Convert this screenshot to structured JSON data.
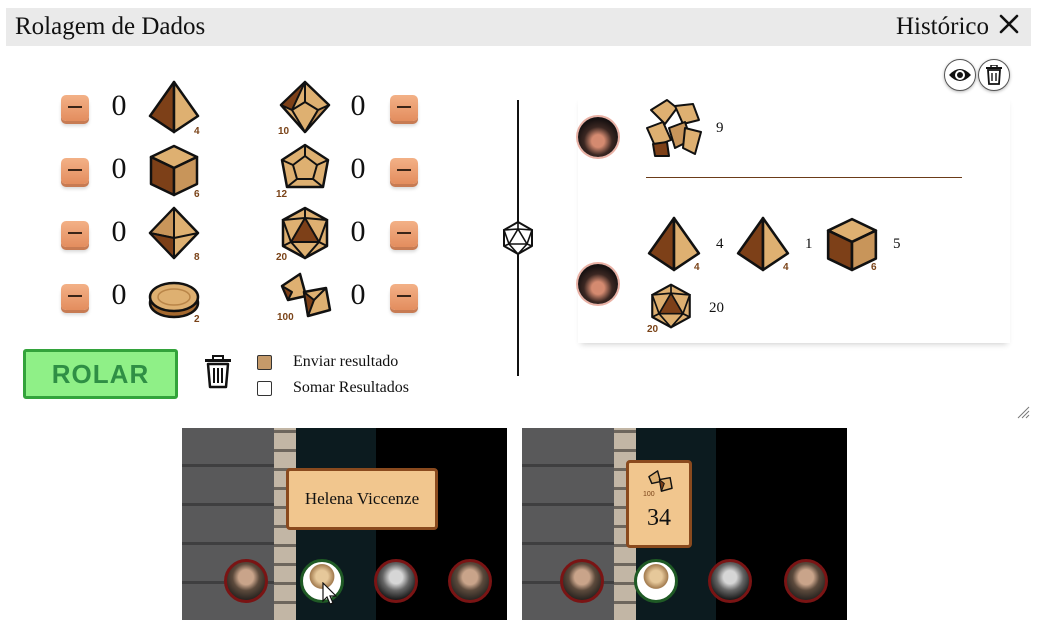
{
  "header": {
    "title": "Rolagem de Dados",
    "history_label": "Histórico"
  },
  "dice_left": [
    {
      "count": "0",
      "label": "4"
    },
    {
      "count": "0",
      "label": "6"
    },
    {
      "count": "0",
      "label": "8"
    },
    {
      "count": "0",
      "label": "2"
    }
  ],
  "dice_right": [
    {
      "count": "0",
      "label": "10"
    },
    {
      "count": "0",
      "label": "12"
    },
    {
      "count": "0",
      "label": "20"
    },
    {
      "count": "0",
      "label": "100"
    }
  ],
  "actions": {
    "roll_label": "ROLAR",
    "send_result_label": "Enviar resultado",
    "sum_results_label": "Somar Resultados",
    "send_result_checked": true,
    "sum_results_checked": false
  },
  "history": {
    "entries": [
      {
        "results": [
          {
            "die": "100",
            "value": "9"
          }
        ]
      },
      {
        "results": [
          {
            "die": "4",
            "label": "4",
            "value": "4"
          },
          {
            "die": "4",
            "label": "4",
            "value": "1"
          },
          {
            "die": "6",
            "label": "6",
            "value": "5"
          },
          {
            "die": "20",
            "label": "20",
            "value": "20"
          }
        ]
      }
    ]
  },
  "preview_left": {
    "tooltip_name": "Helena Viccenze"
  },
  "preview_right": {
    "die_label": "100",
    "result": "34"
  },
  "colors": {
    "die_light": "#deb071",
    "die_dark": "#7d4018",
    "roll_bg": "#8ff087",
    "roll_border": "#33a33b",
    "minus_btn": "#eea075"
  }
}
